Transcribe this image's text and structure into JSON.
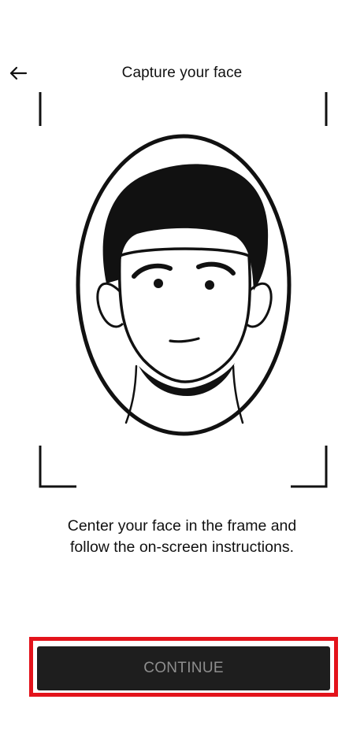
{
  "header": {
    "title": "Capture your face",
    "back_icon": "arrow-left-icon"
  },
  "illustration": {
    "icon": "face-outline-icon"
  },
  "instructions": {
    "line1": "Center your face in the frame and",
    "line2": "follow the on-screen instructions."
  },
  "footer": {
    "continue_label": "CONTINUE",
    "highlight_color": "#e3131b",
    "button_color": "#1e1e1e"
  }
}
